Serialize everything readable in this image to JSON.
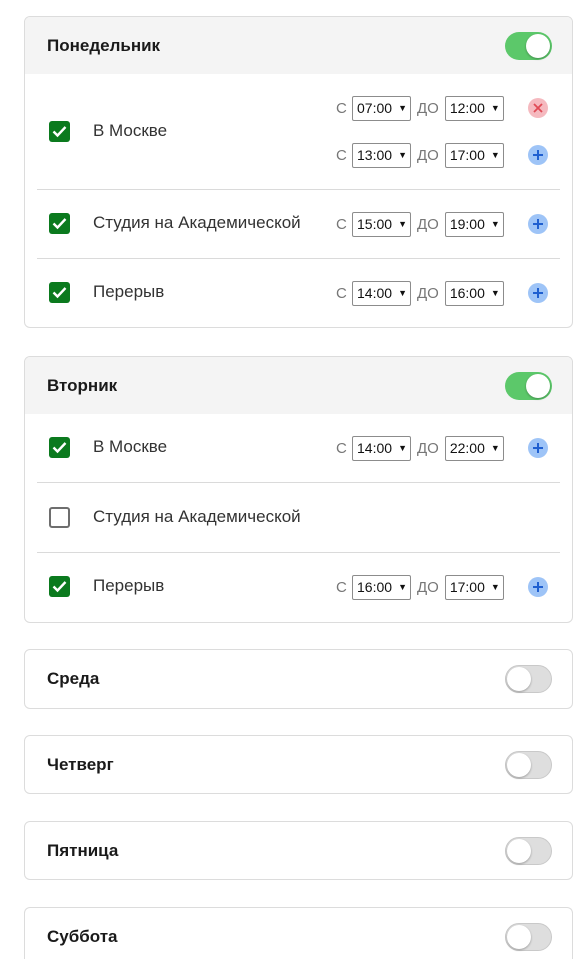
{
  "labels": {
    "from": "С",
    "to": "ДО"
  },
  "days": [
    {
      "name": "Понедельник",
      "enabled": true,
      "locations": [
        {
          "name": "В Москве",
          "checked": true,
          "slots": [
            {
              "from": "07:00",
              "to": "12:00",
              "action": "remove"
            },
            {
              "from": "13:00",
              "to": "17:00",
              "action": "add"
            }
          ]
        },
        {
          "name": "Студия на Академической",
          "checked": true,
          "slots": [
            {
              "from": "15:00",
              "to": "19:00",
              "action": "add"
            }
          ]
        },
        {
          "name": "Перерыв",
          "checked": true,
          "slots": [
            {
              "from": "14:00",
              "to": "16:00",
              "action": "add"
            }
          ]
        }
      ]
    },
    {
      "name": "Вторник",
      "enabled": true,
      "locations": [
        {
          "name": "В Москве",
          "checked": true,
          "slots": [
            {
              "from": "14:00",
              "to": "22:00",
              "action": "add"
            }
          ]
        },
        {
          "name": "Студия на Академической",
          "checked": false,
          "slots": []
        },
        {
          "name": "Перерыв",
          "checked": true,
          "slots": [
            {
              "from": "16:00",
              "to": "17:00",
              "action": "add"
            }
          ]
        }
      ]
    },
    {
      "name": "Среда",
      "enabled": false
    },
    {
      "name": "Четверг",
      "enabled": false
    },
    {
      "name": "Пятница",
      "enabled": false
    },
    {
      "name": "Суббота",
      "enabled": false
    }
  ]
}
